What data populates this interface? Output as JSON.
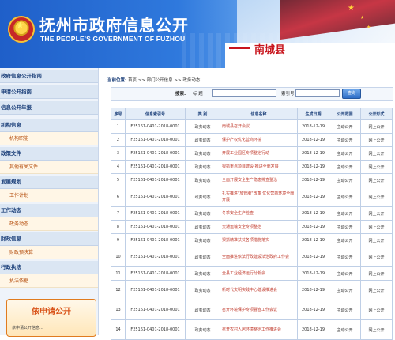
{
  "header": {
    "title": "抚州市政府信息公开",
    "subtitle": "THE PEOPLE'S GOVERNMENT OF FUZHOU",
    "county": "南城县"
  },
  "sidebar": {
    "items": [
      {
        "label": "政府信息公开指南",
        "type": "head"
      },
      {
        "label": "申请公开指南",
        "type": "head"
      },
      {
        "label": "信息公开年报",
        "type": "head"
      },
      {
        "label": "机构信息",
        "type": "head"
      },
      {
        "label": "机构职能",
        "type": "sub"
      },
      {
        "label": "政策文件",
        "type": "head"
      },
      {
        "label": "其他有关文件",
        "type": "sub"
      },
      {
        "label": "发展规划",
        "type": "head"
      },
      {
        "label": "工作计划",
        "type": "sub"
      },
      {
        "label": "工作动态",
        "type": "head"
      },
      {
        "label": "政务动态",
        "type": "sub"
      },
      {
        "label": "财政信息",
        "type": "head"
      },
      {
        "label": "财政预决算",
        "type": "sub"
      },
      {
        "label": "行政执法",
        "type": "head"
      },
      {
        "label": "执法依据",
        "type": "sub"
      }
    ],
    "apply_title": "依申请公开",
    "apply_text": "依申请公开信息..."
  },
  "breadcrumb": {
    "label": "当前位置:",
    "path": "首页 >> 部门公开信息 >> 政务动态"
  },
  "search": {
    "keyword_label": "搜索:",
    "title_label": "标 题",
    "docno_label": "索引号",
    "button": "查询"
  },
  "table": {
    "headers": [
      "序号",
      "信息索引号",
      "类 别",
      "信息名称",
      "生成日期",
      "公开范围",
      "公开形式"
    ],
    "rows": [
      {
        "no": "1",
        "index": "F25161-0401-2018-0001",
        "cat": "政务动态",
        "title": "南城县召开会议",
        "date": "2018-12-19",
        "scope": "主动公开",
        "form": "网上公开"
      },
      {
        "no": "2",
        "index": "F25161-0401-2018-0001",
        "cat": "政务动态",
        "title": "保护产权优化营商环境",
        "date": "2018-12-19",
        "scope": "主动公开",
        "form": "网上公开"
      },
      {
        "no": "3",
        "index": "F25161-0401-2018-0001",
        "cat": "政务动态",
        "title": "开展工业园区专项整治行动",
        "date": "2018-12-19",
        "scope": "主动公开",
        "form": "网上公开"
      },
      {
        "no": "4",
        "index": "F25161-0401-2018-0001",
        "cat": "政务动态",
        "title": "狠抓重点项目建设 推进全面发展",
        "date": "2018-12-19",
        "scope": "主动公开",
        "form": "网上公开"
      },
      {
        "no": "5",
        "index": "F25161-0401-2018-0001",
        "cat": "政务动态",
        "title": "全面开展安全生产隐患排查整治",
        "date": "2018-12-19",
        "scope": "主动公开",
        "form": "网上公开"
      },
      {
        "no": "6",
        "index": "F25161-0401-2018-0001",
        "cat": "政务动态",
        "title": "扎实推进\"放管服\"改革 优化营商环境全面开展",
        "date": "2018-12-19",
        "scope": "主动公开",
        "form": "网上公开"
      },
      {
        "no": "7",
        "index": "F25161-0401-2018-0001",
        "cat": "政务动态",
        "title": "冬季安全生产检查",
        "date": "2018-12-19",
        "scope": "主动公开",
        "form": "网上公开"
      },
      {
        "no": "8",
        "index": "F25161-0401-2018-0001",
        "cat": "政务动态",
        "title": "交通运输安全专项整治",
        "date": "2018-12-19",
        "scope": "主动公开",
        "form": "网上公开"
      },
      {
        "no": "9",
        "index": "F25161-0401-2018-0001",
        "cat": "政务动态",
        "title": "狠抓精准扶贫各项措施落实",
        "date": "2018-12-19",
        "scope": "主动公开",
        "form": "网上公开"
      },
      {
        "no": "10",
        "index": "F25161-0401-2018-0001",
        "cat": "政务动态",
        "title": "全面推进依法行政建设法治政府工作会",
        "date": "2018-12-19",
        "scope": "主动公开",
        "form": "网上公开"
      },
      {
        "no": "11",
        "index": "F25161-0401-2018-0001",
        "cat": "政务动态",
        "title": "全县工业经济运行分析会",
        "date": "2018-12-19",
        "scope": "主动公开",
        "form": "网上公开"
      },
      {
        "no": "12",
        "index": "F25161-0401-2018-0001",
        "cat": "政务动态",
        "title": "新时代文明实践中心建设推进会",
        "date": "2018-12-19",
        "scope": "主动公开",
        "form": "网上公开"
      },
      {
        "no": "13",
        "index": "F25161-0401-2018-0001",
        "cat": "政务动态",
        "title": "召开环境保护专项督查工作会议",
        "date": "2018-12-19",
        "scope": "主动公开",
        "form": "网上公开"
      },
      {
        "no": "14",
        "index": "F25161-0401-2018-0001",
        "cat": "政务动态",
        "title": "召开农村人居环境整治工作推进会",
        "date": "2018-12-19",
        "scope": "主动公开",
        "form": "网上公开"
      }
    ]
  },
  "colors": {
    "banner_blue": "#2f79dd",
    "county_red": "#c8141c",
    "link_red": "#c0392b",
    "sidebar_head": "#1b3f79",
    "sidebar_sub": "#b34a08"
  }
}
